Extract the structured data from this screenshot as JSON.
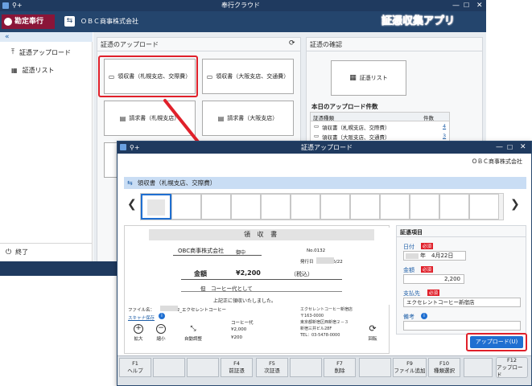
{
  "main_window": {
    "title": "奉行クラウド",
    "brand": "勘定奉行",
    "company": "ＯＢＣ商事株式会社",
    "banner": "証憑収集アプリ",
    "collapse_glyph": "«",
    "nav": [
      {
        "label": "証憑アップロード",
        "icon": "upload-icon"
      },
      {
        "label": "証憑リスト",
        "icon": "list-icon"
      }
    ],
    "exit_label": "終了",
    "upload_section": {
      "title": "証憑のアップロード",
      "buttons": [
        "領収書（札幌支店、交際費）",
        "領収書（大阪支店、交通費）",
        "請求書（札幌支店）",
        "請求書（大阪支店）"
      ]
    },
    "confirm_section": {
      "title": "証憑の確認",
      "list_button": "証憑リスト",
      "today_title": "本日のアップロード件数",
      "table_headers": [
        "証憑種類",
        "件数"
      ],
      "rows": [
        {
          "type": "領収書（札幌支店、交際費）",
          "count": "4"
        },
        {
          "type": "領収書（大阪支店、交通費）",
          "count": "3"
        }
      ]
    }
  },
  "dialog": {
    "title": "証憑アップロード",
    "company": "ＯＢＣ商事株式会社",
    "category": "領収書（札幌支店、交際費）",
    "prev_glyph": "❮",
    "next_glyph": "❯",
    "receipt": {
      "heading": "領 収 書",
      "addressee": "OBC商事株式会社",
      "honorific": "御中",
      "number": "No.0132",
      "issue_date": "発行日　　　　/6/22",
      "amount_label": "金額",
      "amount": "¥2,200",
      "tax_note": "（税込）",
      "memo": "但　コーヒー代として",
      "received": "上記正に領収いたしました。",
      "line_items": [
        "コーヒー代",
        "¥2,000",
        "¥200"
      ],
      "issuer_lines": [
        "エクセレントコーヒー新宿店",
        "〒163-0000",
        "東京都新宿区西新宿２－３",
        "新宿三井ビル28F",
        "TEL：03-5478-0000"
      ]
    },
    "file_name": "ファイル名：　　　10422_エクセレントコーヒー",
    "scan_link": "スキャナ保存",
    "zoom_in": "拡大",
    "zoom_out": "縮小",
    "auto_adjust": "自動調整",
    "rotate": "回転",
    "fields": {
      "section_title": "証憑項目",
      "date_label": "日付",
      "date_value": "年　4月22日",
      "amount_label": "金額",
      "amount_value": "2,200",
      "payee_label": "支払先",
      "payee_value": "エクセレントコーヒー新宿店",
      "note_label": "備考",
      "required": "必須"
    },
    "upload_button": "アップロード(U)"
  },
  "fkeys": [
    {
      "key": "F1",
      "label": "ヘルプ"
    },
    {
      "key": "",
      "label": ""
    },
    {
      "key": "",
      "label": ""
    },
    {
      "key": "F4",
      "label": "前証憑"
    },
    {
      "key": "F5",
      "label": "次証憑"
    },
    {
      "key": "",
      "label": ""
    },
    {
      "key": "F7",
      "label": "削除"
    },
    {
      "key": "",
      "label": ""
    },
    {
      "key": "F9",
      "label": "ファイル追加"
    },
    {
      "key": "F10",
      "label": "種類選択"
    },
    {
      "key": "",
      "label": ""
    },
    {
      "key": "F12",
      "label": "アップロード"
    }
  ],
  "colors": {
    "titlebar": "#1f3a5f",
    "brand": "#8a1538",
    "highlight": "#e0202a",
    "upload": "#1f6fd1",
    "banner": "#ff4a5a"
  }
}
